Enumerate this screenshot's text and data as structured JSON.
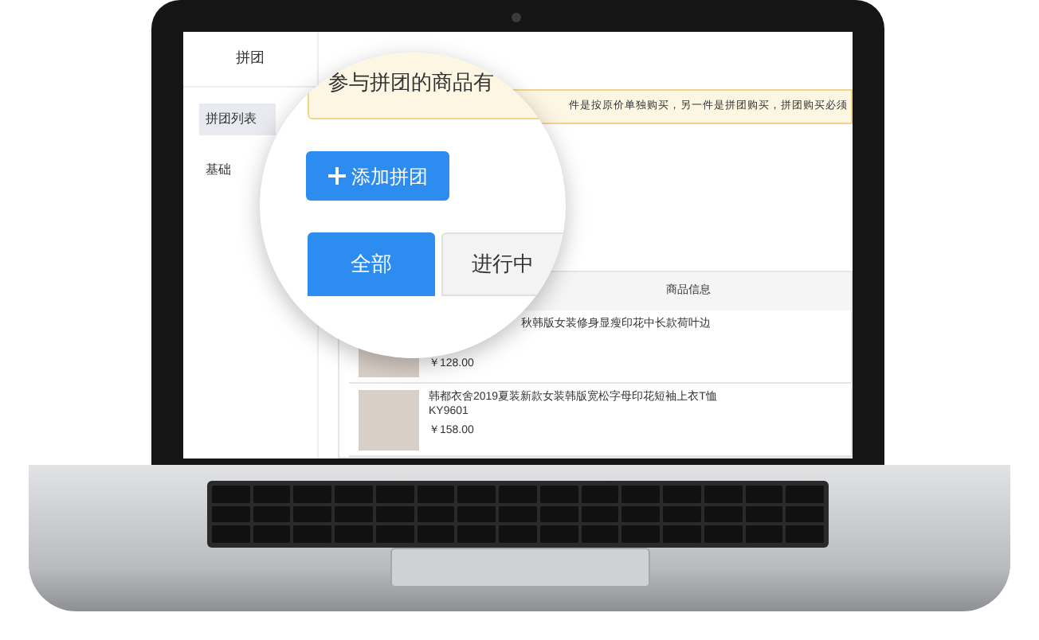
{
  "sidebar": {
    "title": "拼团",
    "items": [
      {
        "label": "拼团列表",
        "selected": true
      },
      {
        "label": "基础",
        "selected": false
      }
    ]
  },
  "notice": "件是按原价单独购买，另一件是拼团购买，拼团购买必须",
  "table": {
    "columns": [
      "商品信息"
    ],
    "rows": [
      {
        "kind": "covered",
        "title": "秋韩版女装修身显瘦印花中长款荷叶边",
        "price": "￥128.00"
      },
      {
        "kind": "plain",
        "title": "韩都衣舍2019夏装新款女装韩版宽松字母印花短袖上衣T恤KY9601",
        "price": "￥158.00"
      }
    ]
  },
  "magnifier": {
    "notice": "参与拼团的商品有",
    "add_button": "添加拼团",
    "tabs": [
      {
        "label": "全部",
        "selected": true
      },
      {
        "label": "进行中",
        "selected": false
      }
    ]
  }
}
